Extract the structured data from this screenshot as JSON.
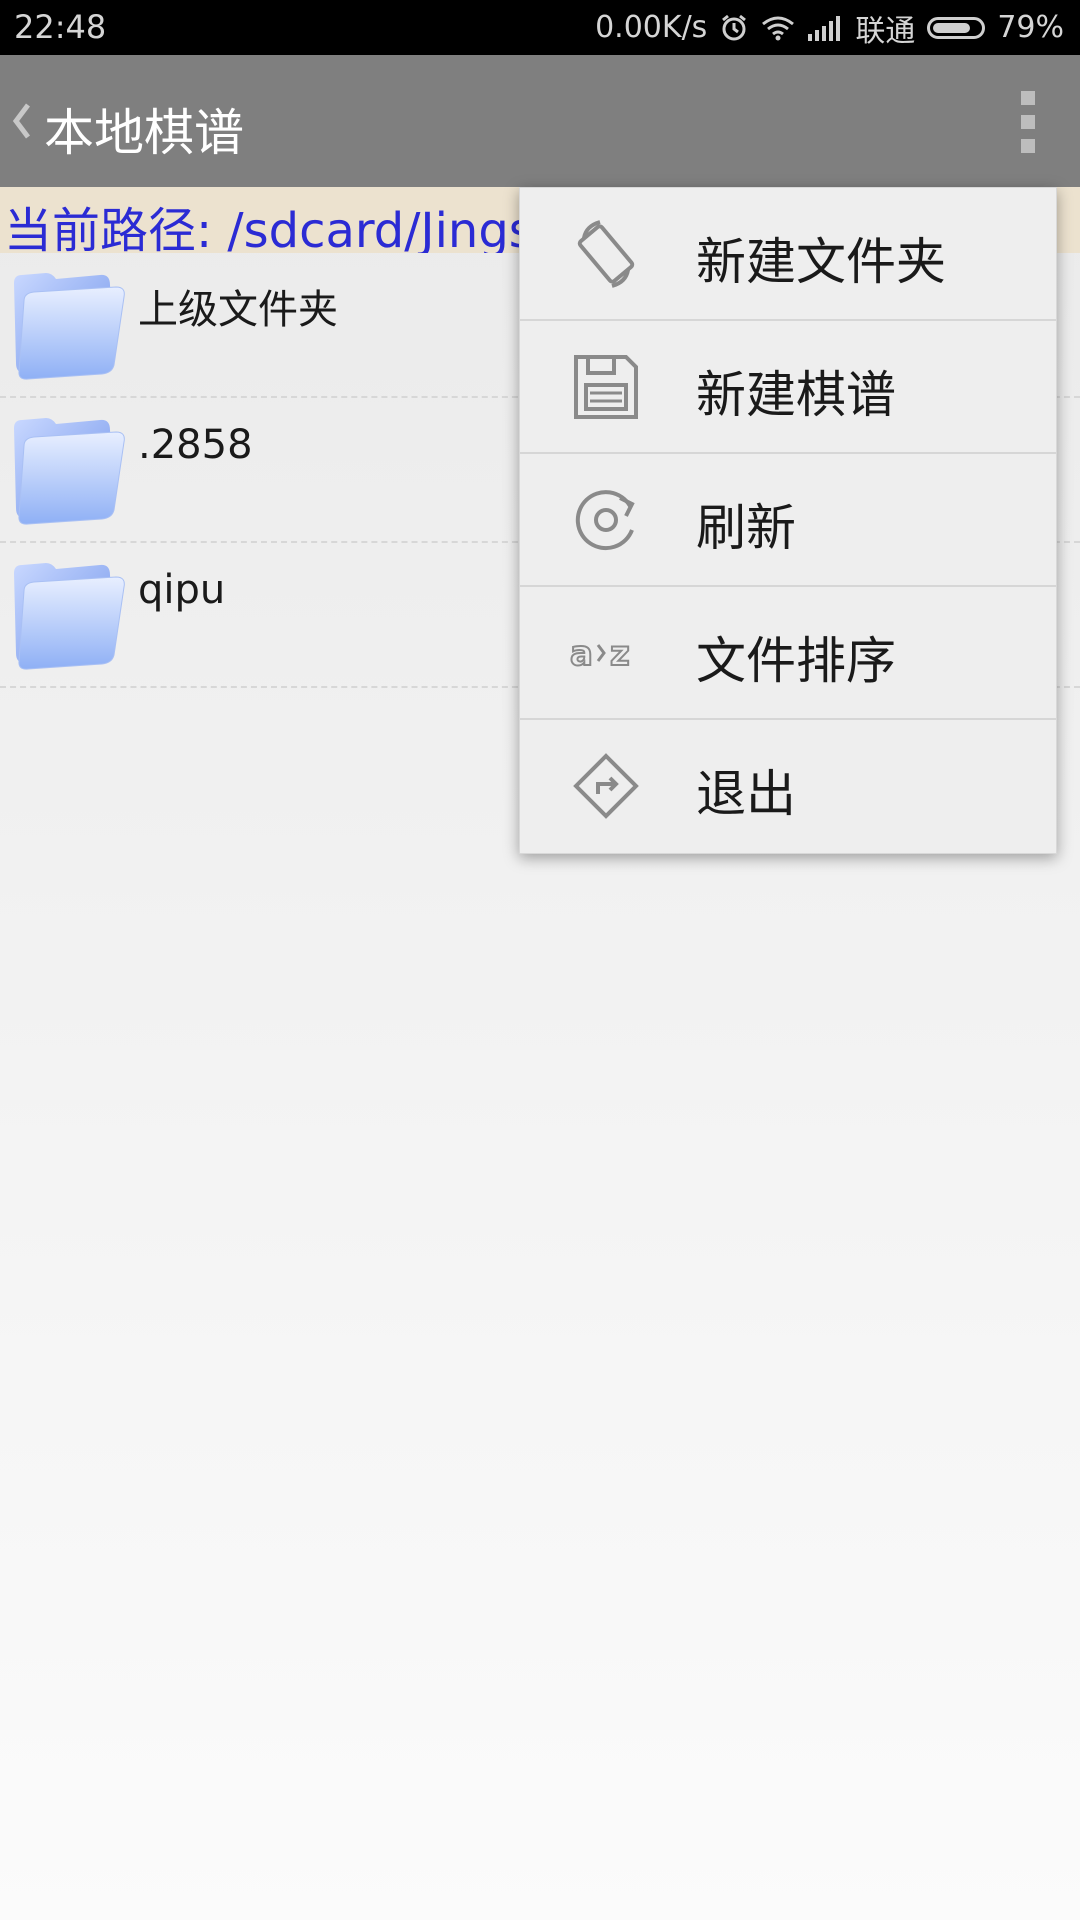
{
  "status_bar": {
    "time": "22:48",
    "network_speed": "0.00K/s",
    "carrier": "联通",
    "battery_percent_text": "79%",
    "battery_level": 0.79,
    "icons": [
      "alarm-icon",
      "wifi-icon",
      "signal-icon",
      "battery-icon"
    ]
  },
  "action_bar": {
    "title": "本地棋谱",
    "back_icon": "back-chevron-icon",
    "overflow_icon": "overflow-menu-icon"
  },
  "path_bar": {
    "text": "当前路径: /sdcard/Jings"
  },
  "files": [
    {
      "name": "上级文件夹",
      "icon": "folder-icon"
    },
    {
      "name": ".2858",
      "icon": "folder-icon"
    },
    {
      "name": "qipu",
      "icon": "folder-icon"
    }
  ],
  "menu": {
    "items": [
      {
        "label": "新建文件夹",
        "icon": "rotate-screen-icon"
      },
      {
        "label": "新建棋谱",
        "icon": "save-disk-icon"
      },
      {
        "label": "刷新",
        "icon": "refresh-icon"
      },
      {
        "label": "文件排序",
        "icon": "sort-az-icon"
      },
      {
        "label": "退出",
        "icon": "exit-diamond-icon"
      }
    ]
  },
  "colors": {
    "status_bar_bg": "#000000",
    "action_bar_bg": "#7f7f7f",
    "path_bar_bg": "#ece2cf",
    "path_text": "#2b2bd4",
    "menu_bg": "#eeeeee",
    "folder_blue": "#8aa8f0"
  }
}
